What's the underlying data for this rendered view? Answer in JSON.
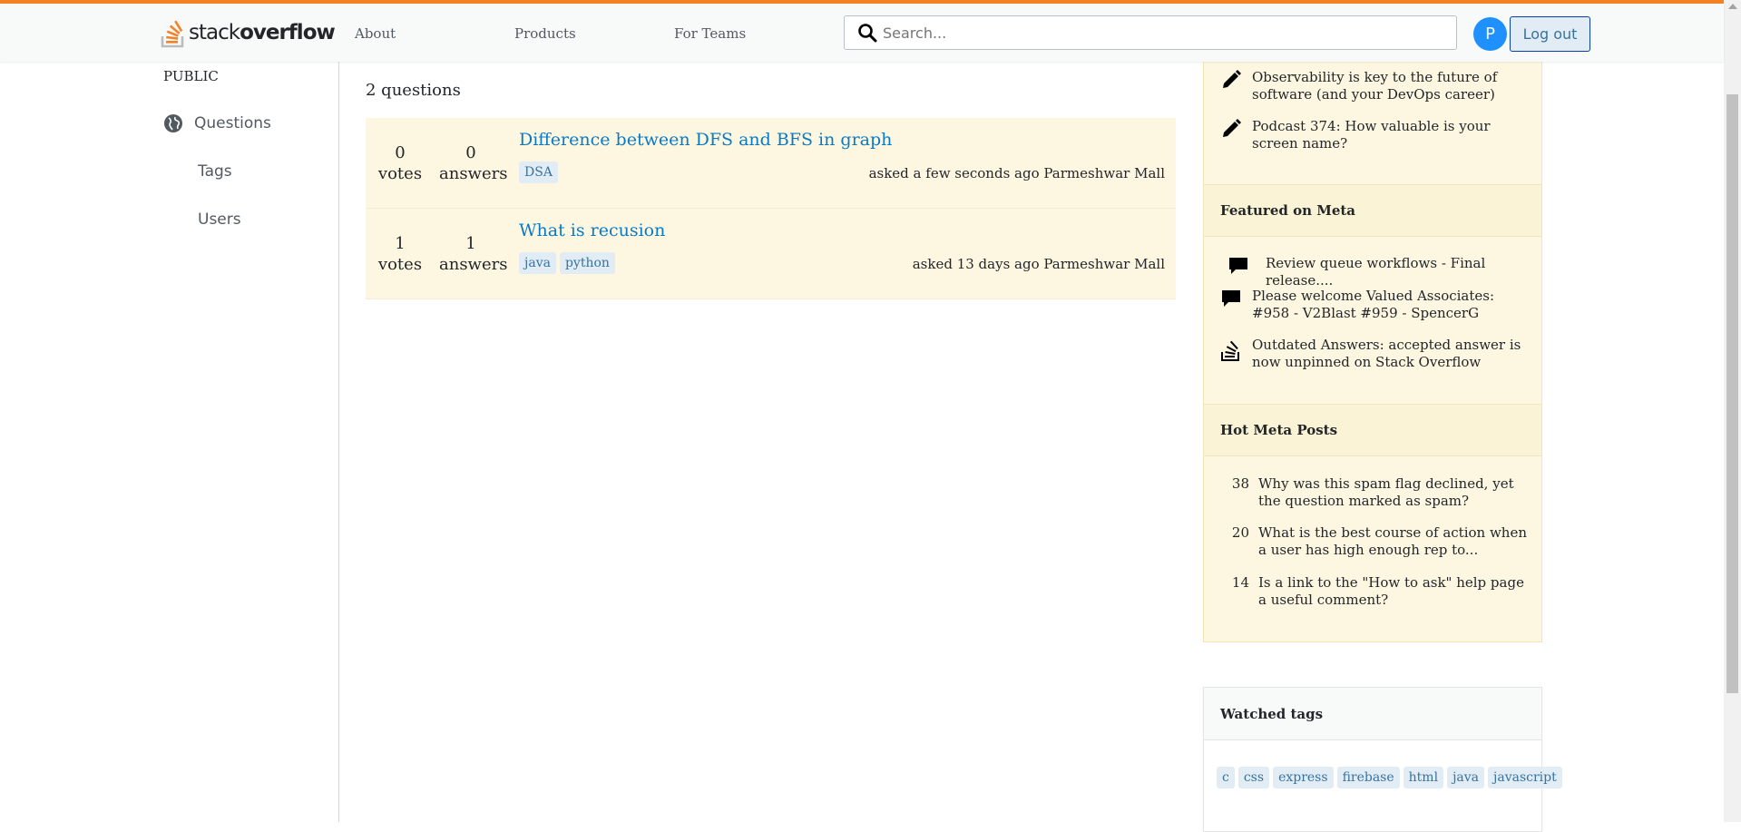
{
  "header": {
    "logo_word_light": "stack",
    "logo_word_bold": "overflow",
    "nav": [
      "About",
      "Products",
      "For Teams"
    ],
    "search_placeholder": "Search...",
    "avatar_initial": "P",
    "logout_label": "Log out"
  },
  "sidebar": {
    "section_label": "PUBLIC",
    "items": [
      {
        "label": "Questions",
        "icon": "globe-icon"
      },
      {
        "label": "Tags"
      },
      {
        "label": "Users"
      }
    ]
  },
  "main": {
    "question_count": "2 questions",
    "questions": [
      {
        "votes": "0",
        "votes_label": "votes",
        "answers": "0",
        "answers_label": "answers",
        "title": "Difference between DFS and BFS in graph",
        "tags": [
          "DSA"
        ],
        "asked": "asked a few seconds ago Parmeshwar Mall"
      },
      {
        "votes": "1",
        "votes_label": "votes",
        "answers": "1",
        "answers_label": "answers",
        "title": "What is recusion",
        "tags": [
          "java",
          "python"
        ],
        "asked": "asked 13 days ago Parmeshwar Mall"
      }
    ]
  },
  "blog": {
    "items": [
      {
        "text": "Observability is key to the future of software (and your DevOps career)",
        "icon": "pencil-icon"
      },
      {
        "text": "Podcast 374: How valuable is your screen name?",
        "icon": "pencil-icon"
      }
    ]
  },
  "featured_meta": {
    "title": "Featured on Meta",
    "items": [
      {
        "text": "Review queue workflows - Final release....",
        "icon": "chat-bubble-icon"
      },
      {
        "text": "Please welcome Valued Associates: #958 - V2Blast #959 - SpencerG",
        "icon": "chat-bubble-icon"
      },
      {
        "text": "Outdated Answers: accepted answer is now unpinned on Stack Overflow",
        "icon": "stack-exchange-icon"
      }
    ]
  },
  "hot_meta": {
    "title": "Hot Meta Posts",
    "items": [
      {
        "count": "38",
        "text": "Why was this spam flag declined, yet the question marked as spam?"
      },
      {
        "count": "20",
        "text": "What is the best course of action when a user has high enough rep to..."
      },
      {
        "count": "14",
        "text": "Is a link to the \"How to ask\" help page a useful comment?"
      }
    ]
  },
  "watched_tags": {
    "title": "Watched tags",
    "tags": [
      "c",
      "css",
      "express",
      "firebase",
      "html",
      "java",
      "javascript"
    ]
  },
  "colors": {
    "accent": "#f48225",
    "link": "#0a7ac4",
    "question_bg": "#fdf7e2",
    "tag_bg": "#e1ecf4",
    "avatar": "#1e90ff"
  }
}
